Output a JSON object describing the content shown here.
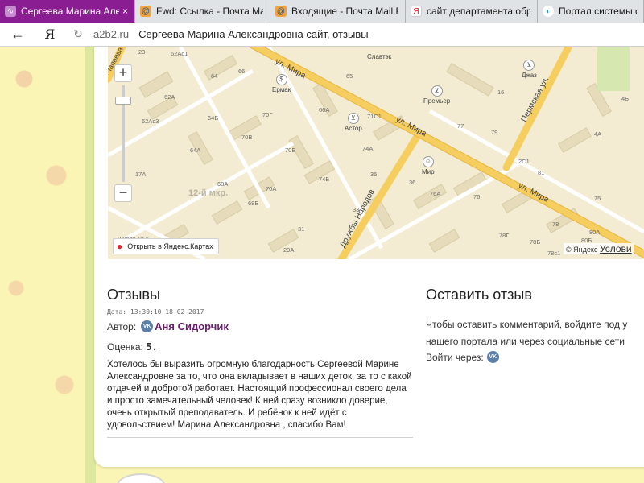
{
  "browser": {
    "tabs": [
      {
        "label": "Сергеева Марина Алекс",
        "icon": "vk-icon",
        "active": true
      },
      {
        "label": "Fwd: Ссылка - Почта Mail.R",
        "icon": "mail-icon",
        "active": false
      },
      {
        "label": "Входящие - Почта Mail.Ru",
        "icon": "mail-icon",
        "active": false
      },
      {
        "label": "сайт департамента образо",
        "icon": "yandex-icon",
        "active": false
      },
      {
        "label": "Портал системы обра",
        "icon": "portal-icon",
        "active": false
      }
    ],
    "address": {
      "back_glyph": "←",
      "yandex_glyph": "Я",
      "reload_glyph": "↻",
      "domain": "a2b2.ru",
      "page_title": "Сергеева Марина Александровна сайт, отзывы"
    }
  },
  "map": {
    "streets": [
      "ул. Мира",
      "ул. Мира",
      "ул. Мира",
      "Пермская ул.",
      "Дружбы Народов",
      "Чапаева"
    ],
    "district": "12-й мкр.",
    "pois": [
      {
        "label": "Ермак",
        "icon": "dollar-icon"
      },
      {
        "label": "Славтэк",
        "icon": ""
      },
      {
        "label": "Премьер",
        "icon": "cart-icon"
      },
      {
        "label": "Джаз",
        "icon": "cart-icon"
      },
      {
        "label": "Астор",
        "icon": "cart-icon"
      },
      {
        "label": "Мир",
        "icon": "person-icon"
      }
    ],
    "building_numbers": [
      "23",
      "62Ас1",
      "66",
      "65",
      "64",
      "62А",
      "64Б",
      "62Ас3",
      "70Г",
      "70В",
      "70Б",
      "70А",
      "66А",
      "71С1",
      "74А",
      "74Б",
      "64А",
      "68А",
      "68Б",
      "17А",
      "35",
      "33",
      "31",
      "29А",
      "36",
      "76А",
      "76",
      "77",
      "79",
      "78",
      "78Г",
      "78Б",
      "75",
      "16",
      "4Б",
      "4А",
      "2С1",
      "81",
      "80Б",
      "80",
      "78с1",
      "80А"
    ],
    "school_label": "Школа № 5",
    "open_link": "Открыть в Яндекс.Картах",
    "copyright": "© Яндекс",
    "conditions": "Услови",
    "zoom_in": "+",
    "zoom_out": "−"
  },
  "reviews": {
    "title": "Отзывы",
    "date_prefix": "Дата:",
    "date": "13:30:10 18-02-2017",
    "author_prefix": "Автор:",
    "author_name": "Аня Сидорчик",
    "rating_prefix": "Оценка:",
    "rating": "5.",
    "vk_glyph": "VK",
    "text": "Хотелось бы выразить огромную благодарность Сергеевой Марине Александровне за то, что она вкладывает в наших деток, за то с какой отдачей и добротой работает. Настоящий профессионал своего дела и просто замечательный человек! К ней сразу возникло доверие, очень открытый преподаватель. И ребёнок к ней идёт с удовольствием! Марина Александровна , спасибо Вам!"
  },
  "leave_review": {
    "title": "Оставить отзыв",
    "text": "Чтобы оставить комментарий, войдите под у нашего портала или через социальные сети",
    "login_label": "Войти через:",
    "vk_glyph": "VK"
  },
  "colors": {
    "tab_active": "#8a1d92",
    "author_link": "#6a1e6d",
    "page_bg": "#fbf5b5",
    "map_road": "#f6cd5f"
  }
}
